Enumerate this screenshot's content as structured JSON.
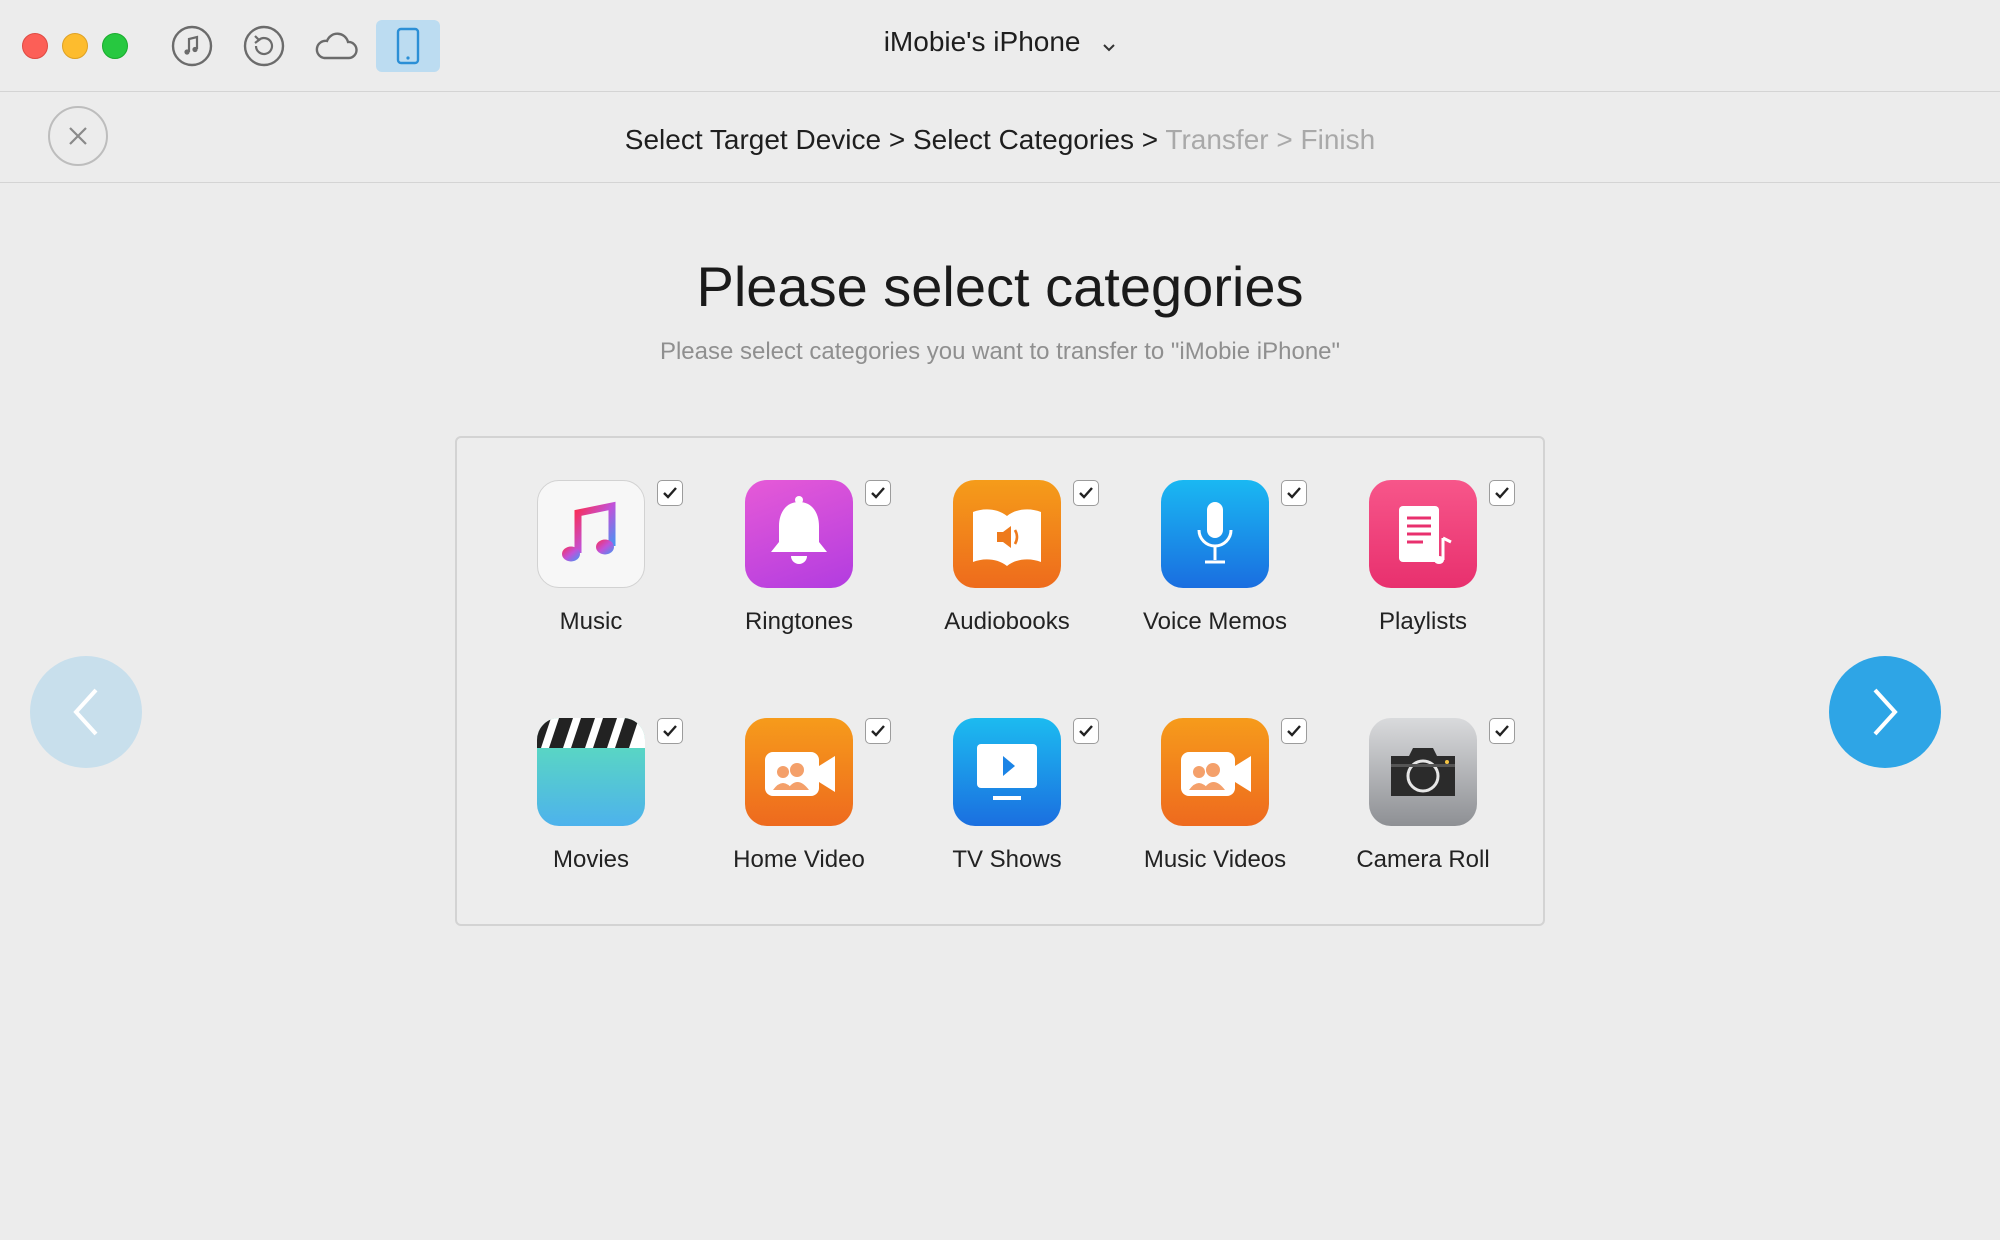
{
  "window": {
    "device_title": "iMobie's iPhone"
  },
  "toolbar": {
    "icons": [
      "music-note-icon",
      "restore-icon",
      "cloud-icon",
      "phone-icon"
    ]
  },
  "steps": {
    "active": "Select Target Device > Select Categories > ",
    "pending": "Transfer > Finish"
  },
  "main": {
    "title": "Please select categories",
    "subtitle": "Please select categories you want to transfer to \"iMobie iPhone\""
  },
  "categories": [
    {
      "label": "Music",
      "checked": true
    },
    {
      "label": "Ringtones",
      "checked": true
    },
    {
      "label": "Audiobooks",
      "checked": true
    },
    {
      "label": "Voice Memos",
      "checked": true
    },
    {
      "label": "Playlists",
      "checked": true
    },
    {
      "label": "Movies",
      "checked": true
    },
    {
      "label": "Home Video",
      "checked": true
    },
    {
      "label": "TV Shows",
      "checked": true
    },
    {
      "label": "Music Videos",
      "checked": true
    },
    {
      "label": "Camera Roll",
      "checked": true
    }
  ],
  "colors": {
    "accent": "#2ea5e6",
    "accent_disabled": "#c8dfec",
    "toolbar_active": "#bcdcf1"
  }
}
